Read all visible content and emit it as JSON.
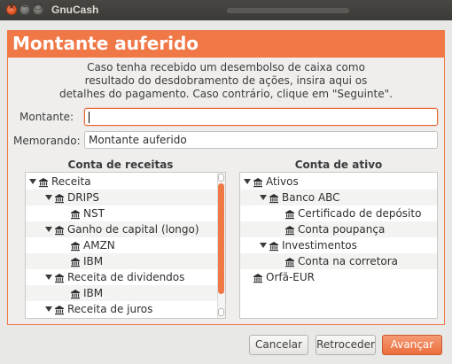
{
  "window": {
    "title": "GnuCash",
    "close_glyph": "×",
    "min_glyph": "–",
    "max_glyph": "□"
  },
  "page": {
    "title": "Montante auferido",
    "description": [
      "Caso tenha recebido um desembolso de caixa como",
      "resultado do desdobramento de ações, insira aqui os",
      "detalhes do pagamento. Caso contrário, clique em \"Seguinte\"."
    ]
  },
  "form": {
    "amount_label": "Montante:",
    "amount_value": "",
    "memo_label": "Memorando:",
    "memo_value": "Montante auferido"
  },
  "income_tree": {
    "header": "Conta de receitas",
    "rows": [
      {
        "label": "Receita",
        "level": 0,
        "expanded": true
      },
      {
        "label": "DRIPS",
        "level": 1,
        "expanded": true
      },
      {
        "label": "NST",
        "level": 2,
        "expanded": false
      },
      {
        "label": "Ganho de capital (longo)",
        "level": 1,
        "expanded": true
      },
      {
        "label": "AMZN",
        "level": 2,
        "expanded": false
      },
      {
        "label": "IBM",
        "level": 2,
        "expanded": false
      },
      {
        "label": "Receita de dividendos",
        "level": 1,
        "expanded": true
      },
      {
        "label": "IBM",
        "level": 2,
        "expanded": false
      },
      {
        "label": "Receita de juros",
        "level": 1,
        "expanded": true
      }
    ]
  },
  "asset_tree": {
    "header": "Conta de ativo",
    "rows": [
      {
        "label": "Ativos",
        "level": 0,
        "expanded": true
      },
      {
        "label": "Banco ABC",
        "level": 1,
        "expanded": true
      },
      {
        "label": "Certificado de depósito",
        "level": 2,
        "expanded": false
      },
      {
        "label": "Conta poupança",
        "level": 2,
        "expanded": false
      },
      {
        "label": "Investimentos",
        "level": 1,
        "expanded": true
      },
      {
        "label": "Conta na corretora",
        "level": 2,
        "expanded": false
      },
      {
        "label": "Orfã-EUR",
        "level": 0,
        "expanded": false
      }
    ]
  },
  "buttons": {
    "cancel": "Cancelar",
    "back": "Retroceder",
    "next": "Avançar"
  },
  "colors": {
    "accent": "#f07746"
  },
  "icons": {
    "expander": "expander-down-icon",
    "account": "bank-account-icon"
  }
}
